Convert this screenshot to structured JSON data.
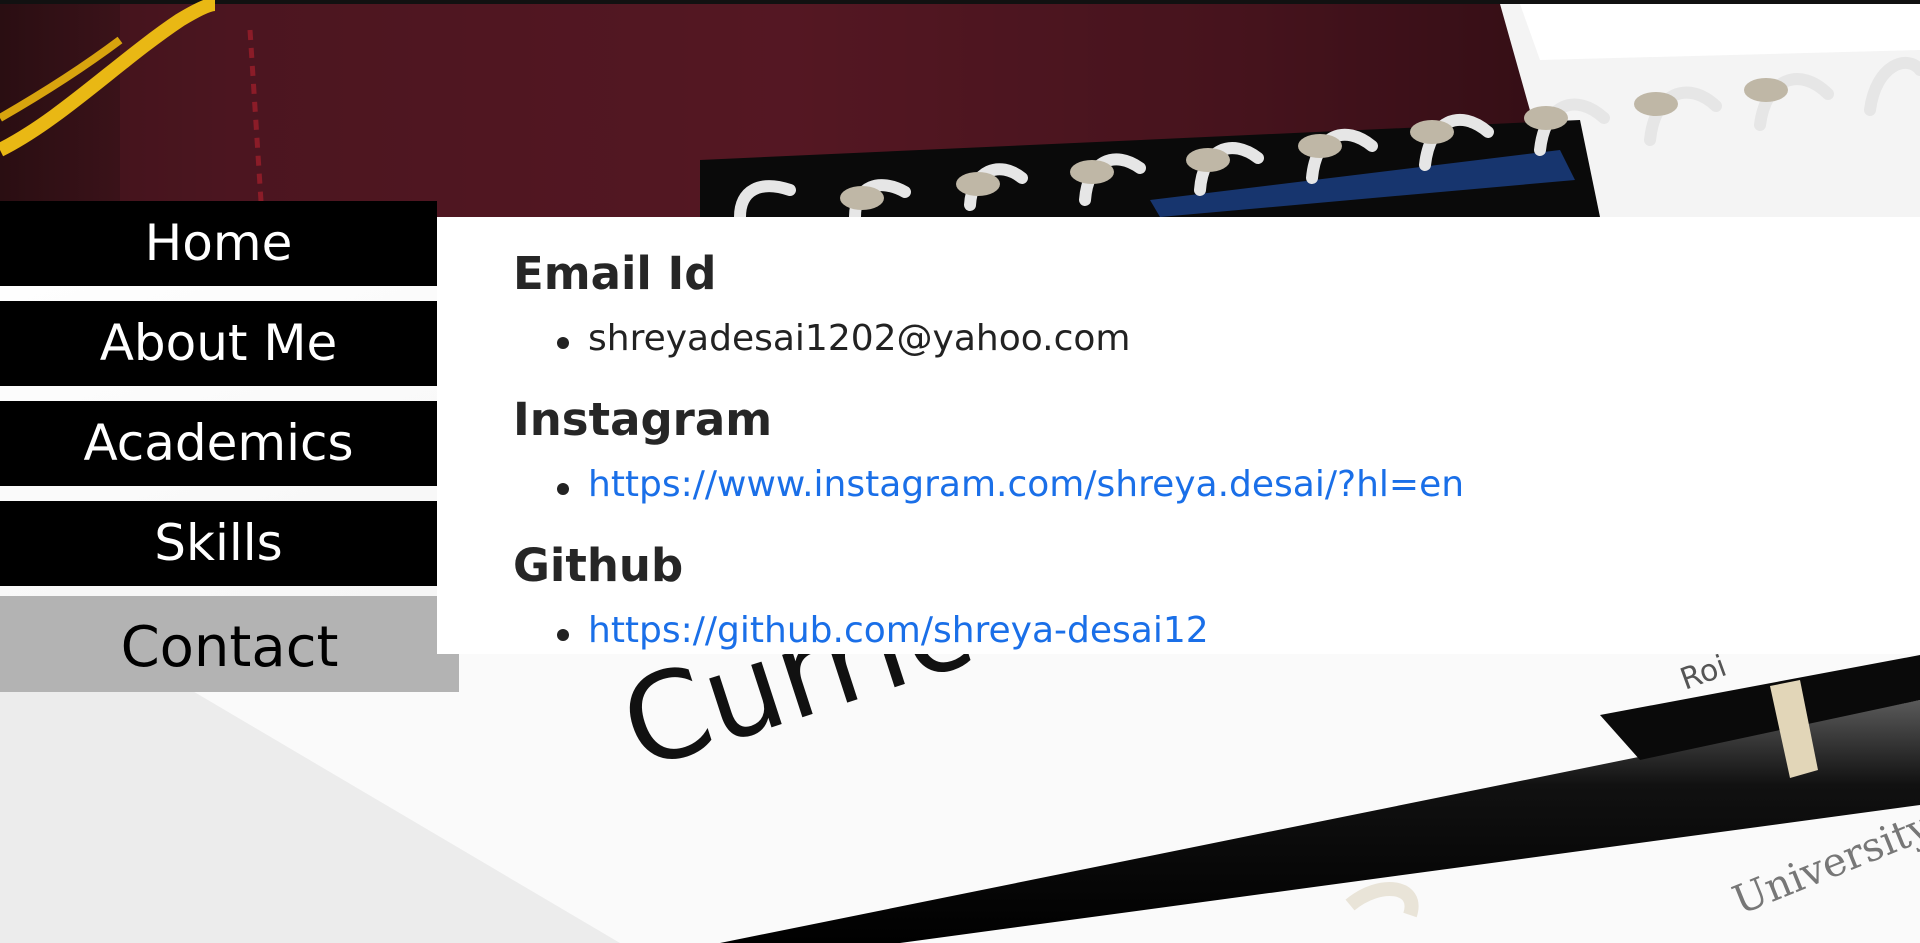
{
  "nav": {
    "items": [
      {
        "label": "Home",
        "active": false
      },
      {
        "label": "About Me",
        "active": false
      },
      {
        "label": "Academics",
        "active": false
      },
      {
        "label": "Skills",
        "active": false
      },
      {
        "label": "Contact",
        "active": true
      }
    ]
  },
  "contact": {
    "email": {
      "heading": "Email Id",
      "value": "shreyadesai1202@yahoo.com"
    },
    "instagram": {
      "heading": "Instagram",
      "url": "https://www.instagram.com/shreya.desai/?hl=en"
    },
    "github": {
      "heading": "Github",
      "url": "https://github.com/shreya-desai12"
    }
  },
  "background": {
    "resume_title": "Curric",
    "university_text": "University",
    "objective_text": "Roi"
  },
  "colors": {
    "nav_bg": "#000000",
    "nav_text": "#ffffff",
    "nav_active_bg": "#b3b3b3",
    "nav_active_text": "#000000",
    "heading": "#262626",
    "link": "#1a6fe8"
  }
}
